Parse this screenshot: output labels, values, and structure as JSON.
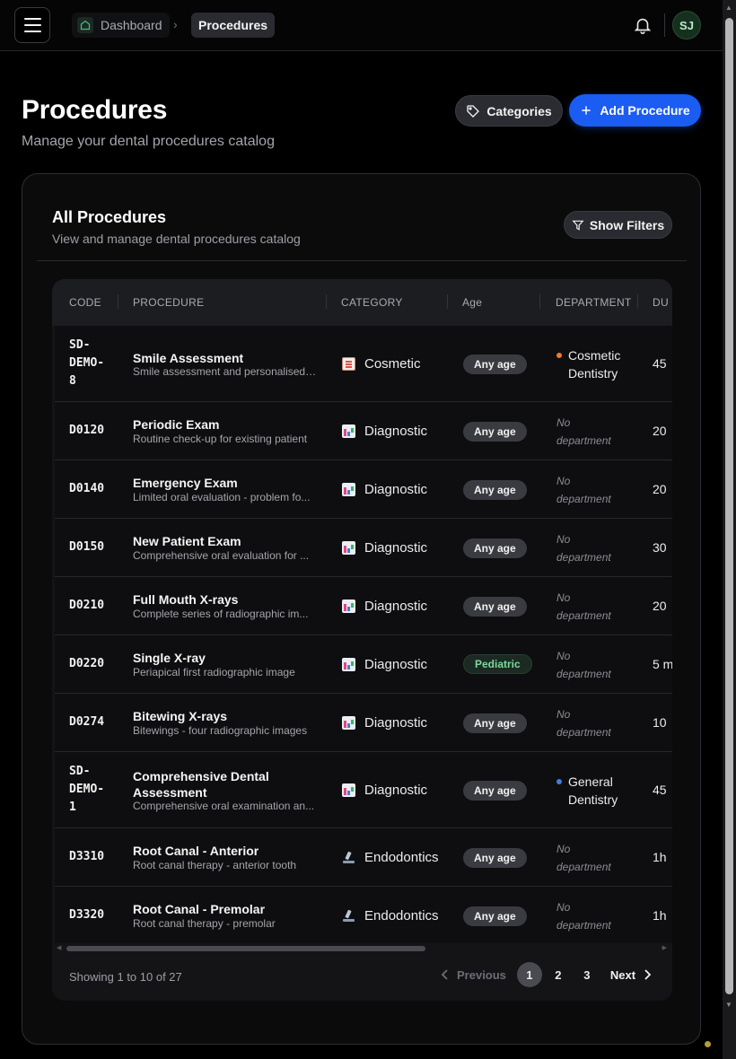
{
  "topbar": {
    "breadcrumb": [
      {
        "label": "Dashboard"
      },
      {
        "label": "Procedures"
      }
    ],
    "avatar_initials": "SJ"
  },
  "header": {
    "title": "Procedures",
    "subtitle": "Manage your dental procedures catalog",
    "categories_button": "Categories",
    "add_button": "Add Procedure"
  },
  "card": {
    "title": "All Procedures",
    "subtitle": "View and manage dental procedures catalog",
    "filters_button": "Show Filters"
  },
  "table": {
    "columns": [
      "CODE",
      "PROCEDURE",
      "CATEGORY",
      "Age",
      "DEPARTMENT",
      "DU"
    ],
    "rows": [
      {
        "code_lines": [
          "SD-",
          "DEMO-",
          "8"
        ],
        "name": "Smile Assessment",
        "desc": "Smile assessment and personalised ...",
        "category": "Cosmetic",
        "category_icon": "clipboard-icon",
        "age": "Any age",
        "department_lines": [
          "Cosmetic",
          "Dentistry"
        ],
        "department_color": "#f07b2b",
        "duration": "45"
      },
      {
        "code": "D0120",
        "name": "Periodic Exam",
        "desc": "Routine check-up for existing patient",
        "category": "Diagnostic",
        "category_icon": "bar-chart-icon",
        "age": "Any age",
        "no_department_lines": [
          "No",
          "department"
        ],
        "duration": "20"
      },
      {
        "code": "D0140",
        "name": "Emergency Exam",
        "desc": "Limited oral evaluation - problem fo...",
        "category": "Diagnostic",
        "category_icon": "bar-chart-icon",
        "age": "Any age",
        "no_department_lines": [
          "No",
          "department"
        ],
        "duration": "20"
      },
      {
        "code": "D0150",
        "name": "New Patient Exam",
        "desc": "Comprehensive oral evaluation for ...",
        "category": "Diagnostic",
        "category_icon": "bar-chart-icon",
        "age": "Any age",
        "no_department_lines": [
          "No",
          "department"
        ],
        "duration": "30"
      },
      {
        "code": "D0210",
        "name": "Full Mouth X-rays",
        "desc": "Complete series of radiographic im...",
        "category": "Diagnostic",
        "category_icon": "bar-chart-icon",
        "age": "Any age",
        "no_department_lines": [
          "No",
          "department"
        ],
        "duration": "20"
      },
      {
        "code": "D0220",
        "name": "Single X-ray",
        "desc": "Periapical first radiographic image",
        "category": "Diagnostic",
        "category_icon": "bar-chart-icon",
        "age": "Pediatric",
        "no_department_lines": [
          "No",
          "department"
        ],
        "duration": "5 m"
      },
      {
        "code": "D0274",
        "name": "Bitewing X-rays",
        "desc": "Bitewings - four radiographic images",
        "category": "Diagnostic",
        "category_icon": "bar-chart-icon",
        "age": "Any age",
        "no_department_lines": [
          "No",
          "department"
        ],
        "duration": "10"
      },
      {
        "code_lines": [
          "SD-",
          "DEMO-",
          "1"
        ],
        "name_lines": [
          "Comprehensive Dental",
          "Assessment"
        ],
        "desc": "Comprehensive oral examination an...",
        "category": "Diagnostic",
        "category_icon": "bar-chart-icon",
        "age": "Any age",
        "department_lines": [
          "General",
          "Dentistry"
        ],
        "department_color": "#3f7ee0",
        "duration": "45"
      },
      {
        "code": "D3310",
        "name": "Root Canal - Anterior",
        "desc": "Root canal therapy - anterior tooth",
        "category": "Endodontics",
        "category_icon": "microscope-icon",
        "age": "Any age",
        "no_department_lines": [
          "No",
          "department"
        ],
        "duration": "1h"
      },
      {
        "code": "D3320",
        "name": "Root Canal - Premolar",
        "desc": "Root canal therapy - premolar",
        "category": "Endodontics",
        "category_icon": "microscope-icon",
        "age": "Any age",
        "no_department_lines": [
          "No",
          "department"
        ],
        "duration": "1h"
      }
    ]
  },
  "pagination": {
    "showing": "Showing 1 to 10 of 27",
    "previous": "Previous",
    "pages": [
      "1",
      "2",
      "3"
    ],
    "active_page": "1",
    "next": "Next"
  }
}
